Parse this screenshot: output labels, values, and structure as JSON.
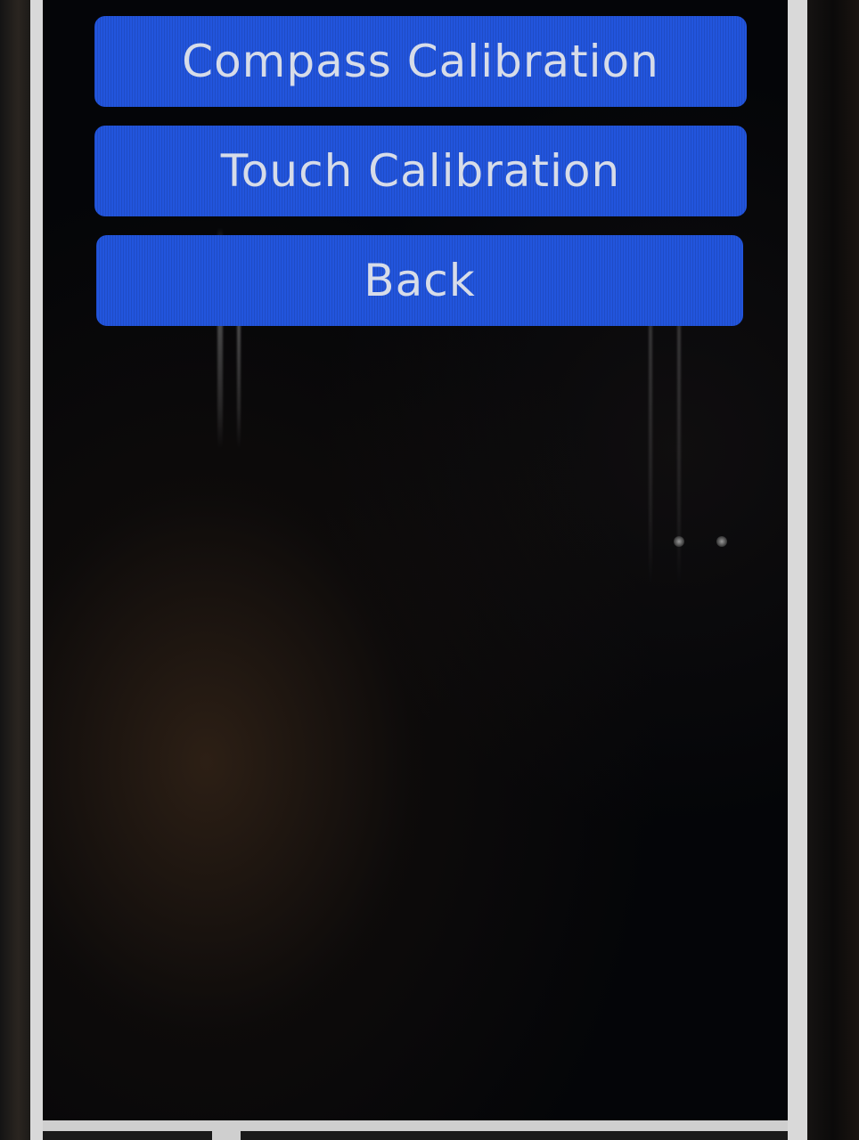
{
  "menu": {
    "buttons": [
      {
        "label": "Compass Calibration"
      },
      {
        "label": "Touch Calibration"
      },
      {
        "label": "Back"
      }
    ]
  },
  "colors": {
    "button_fill": "#2255dd",
    "button_text": "#d7dce8",
    "screen_background": "#040508"
  }
}
